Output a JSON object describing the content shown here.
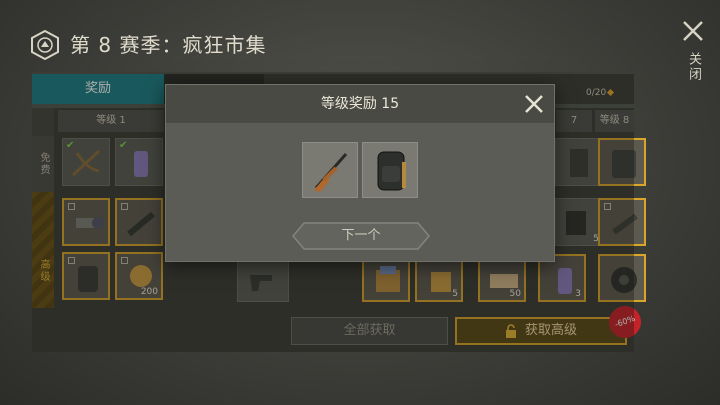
{
  "header": {
    "season_title": "第 8 赛季：疯狂市集",
    "close_label": "关闭"
  },
  "tabs": {
    "rewards_label": "奖励"
  },
  "progress": {
    "count": "0/20"
  },
  "rows": {
    "free_label": "免费",
    "premium_label": "高级"
  },
  "columns": [
    {
      "label": "等级 1"
    },
    {
      "label": "7"
    },
    {
      "label": "等级 8"
    }
  ],
  "slot_quantities": [
    "200",
    "5",
    "5",
    "50",
    "3"
  ],
  "buttons": {
    "claim_all": "全部获取",
    "get_premium": "获取高级"
  },
  "badge": {
    "discount": "-60%"
  },
  "modal": {
    "title": "等级奖励 15",
    "rewards": [
      {
        "icon": "rifle-icon"
      },
      {
        "icon": "backpack-icon"
      }
    ],
    "next_label": "下一个"
  },
  "colors": {
    "accent_teal": "#1c7f86",
    "gold": "#d9a52b",
    "discount_red": "#c5232a"
  }
}
